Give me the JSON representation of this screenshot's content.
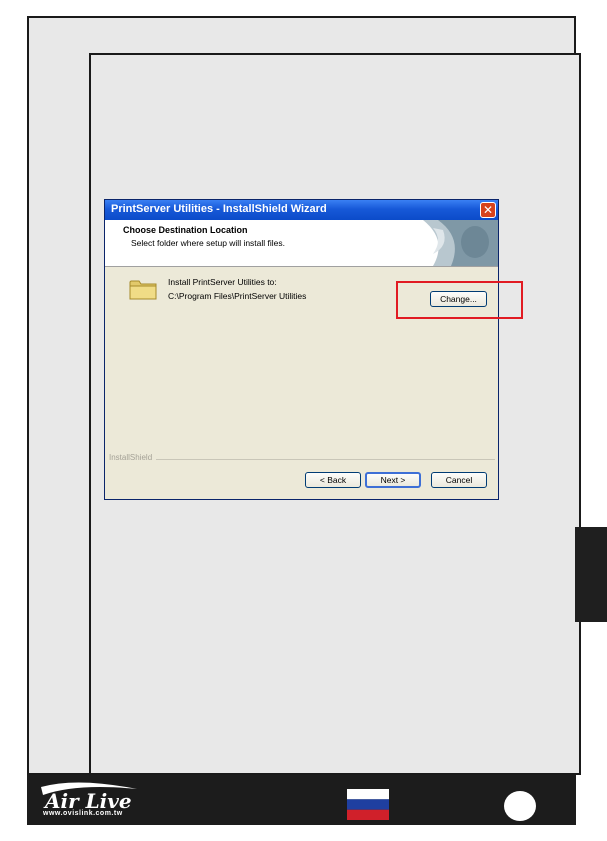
{
  "wizard": {
    "title": "PrintServer Utilities - InstallShield Wizard",
    "close_glyph": "✕",
    "header_title": "Choose Destination Location",
    "header_subtitle": "Select folder where setup will install files.",
    "install_label": "Install PrintServer Utilities to:",
    "install_path": "C:\\Program Files\\PrintServer Utilities",
    "change_button": "Change...",
    "installshield_label": "InstallShield",
    "back_button": "< Back",
    "next_button": "Next >",
    "cancel_button": "Cancel"
  },
  "footer": {
    "brand": "Air Live",
    "url": "www.ovislink.com.tw",
    "flag_colors": [
      "#ffffff",
      "#1f3fa0",
      "#d0202a"
    ]
  },
  "colors": {
    "highlight": "#e11b22",
    "titlebar": "#0b4bc9",
    "dialog_bg": "#ece9d8"
  },
  "icons": [
    "folder-icon",
    "close-icon",
    "air-live-logo",
    "russia-flag-icon"
  ]
}
